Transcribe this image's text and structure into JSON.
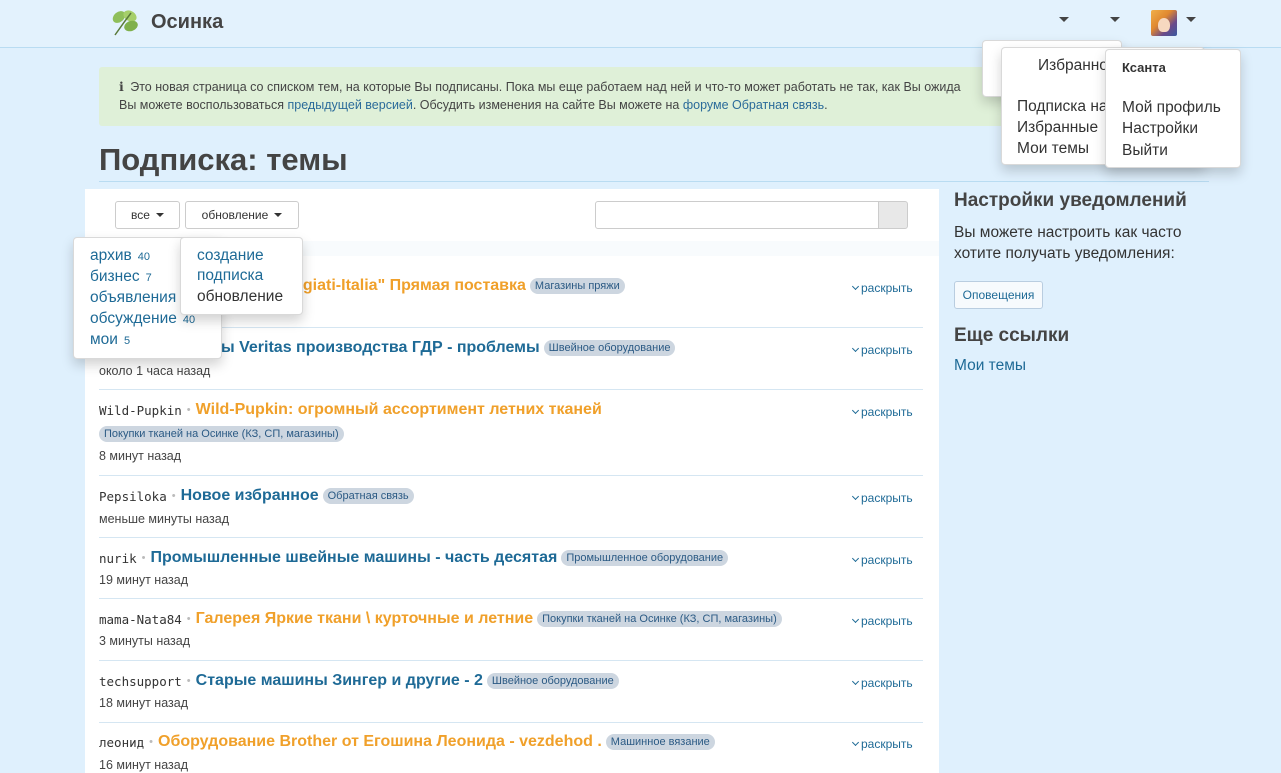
{
  "navbar": {
    "brand": "Осинка",
    "user_menu": {
      "username": "Ксанта",
      "items": [
        "Мой профиль",
        "Настройки",
        "Выйти"
      ]
    },
    "fav_menu": {
      "top_item": "Избранное",
      "items": [
        "Подписка на",
        "Избранные",
        "Мои темы"
      ]
    }
  },
  "alert": {
    "icon": "ℹ",
    "line1": "Это новая страница со списком тем, на которые Вы подписаны. Пока мы еще работаем над ней и что-то может работать не так, как Вы ожида",
    "line2_pre": "Вы можете воспользоваться ",
    "line2_link1": "предыдущей версией",
    "line2_mid": ". Обсудить изменения на сайте Вы можете на ",
    "line2_link2": "форуме Обратная связь",
    "line2_post": "."
  },
  "page_title": "Подписка: темы",
  "filters": {
    "category_button": "все",
    "sort_button": "обновление",
    "category_options": [
      {
        "label": "архив",
        "count": "40"
      },
      {
        "label": "бизнес",
        "count": "7"
      },
      {
        "label": "объявления",
        "count": ""
      },
      {
        "label": "обсуждение",
        "count": "40"
      },
      {
        "label": "мои",
        "count": "5"
      }
    ],
    "sort_options": [
      "создание",
      "подписка",
      "обновление"
    ],
    "search_value": ""
  },
  "topics": [
    {
      "author": "",
      "title": "pregiati-Italia\" Прямая поставка",
      "color": "orange",
      "badge": "Магазины пряжи",
      "time": "",
      "expand": "раскрыть"
    },
    {
      "author": "",
      "title": "ы Veritas производства ГДР - проблемы",
      "color": "blue",
      "badge": "Швейное оборудование",
      "time": "около 1 часа назад",
      "expand": "раскрыть"
    },
    {
      "author": "Wild-Pupkin",
      "title": "Wild-Pupkin: огромный ассортимент летних тканей",
      "color": "orange",
      "badge": "Покупки тканей на Осинке (КЗ, СП, магазины)",
      "time": "8 минут назад",
      "expand": "раскрыть"
    },
    {
      "author": "Pepsiloka",
      "title": "Новое избранное",
      "color": "blue",
      "badge": "Обратная связь",
      "time": "меньше минуты назад",
      "expand": "раскрыть"
    },
    {
      "author": "nurik",
      "title": "Промышленные швейные машины - часть десятая",
      "color": "blue",
      "badge": "Промышленное оборудование",
      "time": "19 минут назад",
      "expand": "раскрыть"
    },
    {
      "author": "mama-Nata84",
      "title": "Галерея Яркие ткани \\ курточные и летние",
      "color": "orange",
      "badge": "Покупки тканей на Осинке (КЗ, СП, магазины)",
      "time": "3 минуты назад",
      "expand": "раскрыть"
    },
    {
      "author": "techsupport",
      "title": "Старые машины Зингер и другие - 2",
      "color": "blue",
      "badge": "Швейное оборудование",
      "time": "18 минут назад",
      "expand": "раскрыть"
    },
    {
      "author": "леонид",
      "title": "Оборудование Brother от Егошина Леонида - vezdehod .",
      "color": "orange",
      "badge": "Машинное вязание",
      "time": "16 минут назад",
      "expand": "раскрыть"
    }
  ],
  "sidebar": {
    "notif_heading": "Настройки уведомлений",
    "notif_text": "Вы можете настроить как часто хотите получать уведомления:",
    "notif_button": "Оповещения",
    "links_heading": "Еще ссылки",
    "links": [
      "Мои темы"
    ]
  }
}
